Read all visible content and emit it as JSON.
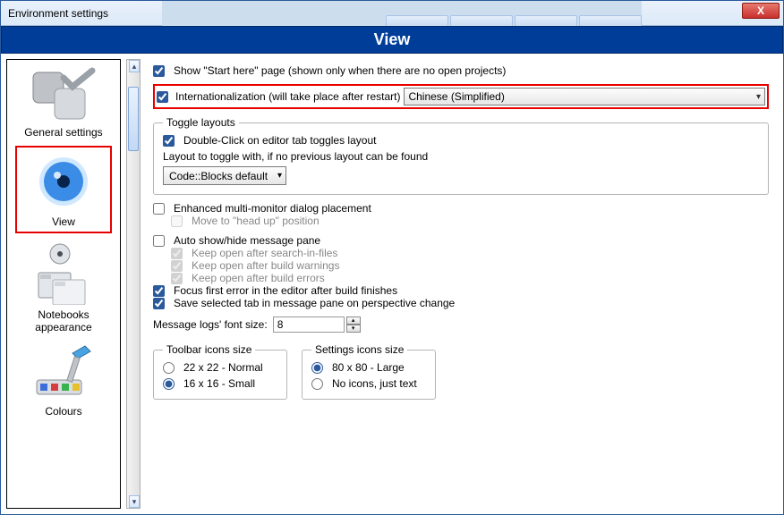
{
  "window": {
    "title": "Environment settings",
    "close": "X"
  },
  "header": "View",
  "sidebar": {
    "items": [
      {
        "label": "General settings"
      },
      {
        "label": "View"
      },
      {
        "label": "Notebooks appearance"
      },
      {
        "label": "Colours"
      }
    ]
  },
  "top": {
    "show_start": "Show \"Start here\" page (shown only when there are no open projects)",
    "i18n_label": "Internationalization (will take place after restart)",
    "i18n_value": "Chinese (Simplified)"
  },
  "toggle_layouts": {
    "legend": "Toggle layouts",
    "dblclick": "Double-Click on editor tab toggles layout",
    "layout_label": "Layout to toggle with, if no previous layout can be found",
    "layout_value": "Code::Blocks default"
  },
  "multi_monitor": {
    "enhanced": "Enhanced multi-monitor dialog placement",
    "headup": "Move to \"head up\" position"
  },
  "msg_pane": {
    "auto": "Auto show/hide message pane",
    "k1": "Keep open after search-in-files",
    "k2": "Keep open after build warnings",
    "k3": "Keep open after build errors",
    "focus": "Focus first error in the editor after build finishes",
    "save_tab": "Save selected tab in message pane on perspective change"
  },
  "font_size": {
    "label": "Message logs' font size:",
    "value": "8"
  },
  "toolbar_icons": {
    "legend": "Toolbar icons size",
    "r1": "22 x 22 - Normal",
    "r2": "16 x 16 - Small"
  },
  "settings_icons": {
    "legend": "Settings icons size",
    "r1": "80 x 80 - Large",
    "r2": "No icons, just text"
  }
}
